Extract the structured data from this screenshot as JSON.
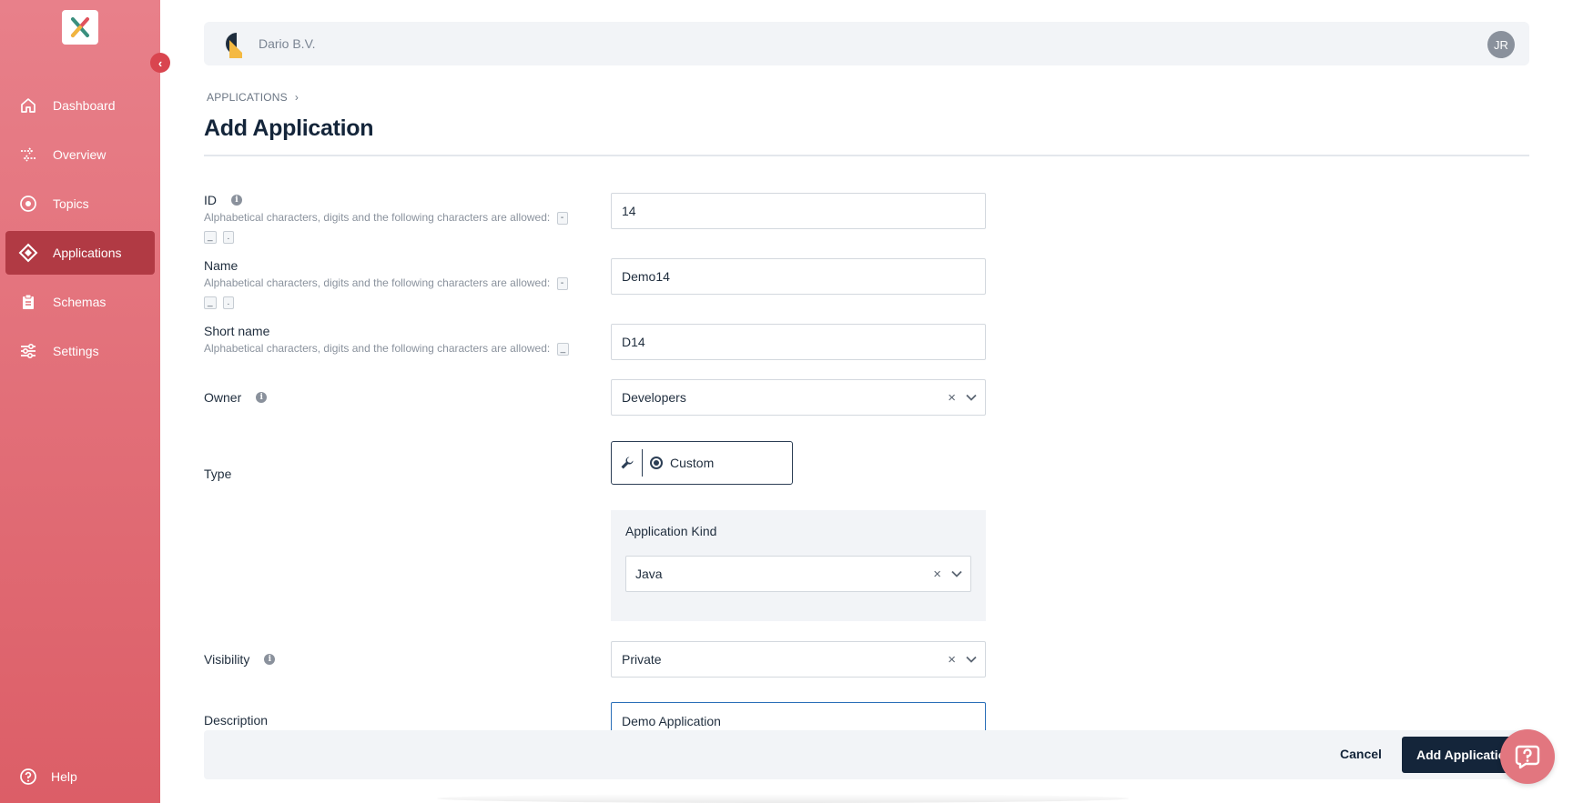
{
  "sidebar": {
    "items": [
      {
        "label": "Dashboard",
        "icon": "home-icon"
      },
      {
        "label": "Overview",
        "icon": "arrows-icon"
      },
      {
        "label": "Topics",
        "icon": "target-icon"
      },
      {
        "label": "Applications",
        "icon": "diamond-icon",
        "active": true
      },
      {
        "label": "Schemas",
        "icon": "clipboard-icon"
      },
      {
        "label": "Settings",
        "icon": "sliders-icon"
      }
    ],
    "help_label": "Help"
  },
  "header": {
    "org_name": "Dario B.V.",
    "avatar_initials": "JR"
  },
  "breadcrumb": {
    "root": "APPLICATIONS"
  },
  "page": {
    "title": "Add Application"
  },
  "form": {
    "id": {
      "label": "ID",
      "hint": "Alphabetical characters, digits and the following characters are allowed:",
      "chips": [
        "-",
        "_",
        "."
      ],
      "value": "14"
    },
    "name": {
      "label": "Name",
      "hint": "Alphabetical characters, digits and the following characters are allowed:",
      "chips": [
        "-",
        "_",
        "."
      ],
      "value": "Demo14"
    },
    "short_name": {
      "label": "Short name",
      "hint": "Alphabetical characters, digits and the following characters are allowed:",
      "chips": [
        "_"
      ],
      "value": "D14"
    },
    "owner": {
      "label": "Owner",
      "value": "Developers"
    },
    "type": {
      "label": "Type",
      "option": "Custom"
    },
    "application_kind": {
      "label": "Application Kind",
      "value": "Java"
    },
    "visibility": {
      "label": "Visibility",
      "value": "Private"
    },
    "description": {
      "label": "Description",
      "value": "Demo Application"
    }
  },
  "actions": {
    "cancel_label": "Cancel",
    "submit_label": "Add Application"
  },
  "colors": {
    "sidebar_top": "#e8808a",
    "sidebar_bottom": "#dc5e67",
    "sidebar_active": "#b13a44",
    "primary": "#14253a"
  }
}
